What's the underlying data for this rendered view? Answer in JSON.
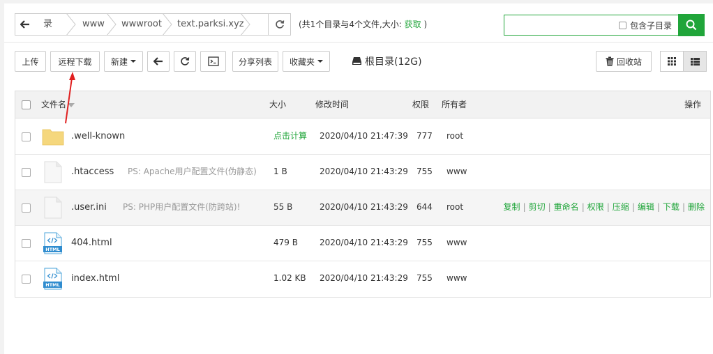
{
  "path": {
    "crumbs": [
      "录",
      "www",
      "wwwroot",
      "text.parksi.xyz"
    ],
    "info_prefix": "(共1个目录与4个文件,大小:",
    "info_link": "获取",
    "info_suffix": ")"
  },
  "search": {
    "placeholder": "",
    "subdir_label": "包含子目录"
  },
  "toolbar": {
    "upload": "上传",
    "remote_download": "远程下载",
    "new": "新建",
    "share_list": "分享列表",
    "favorites": "收藏夹",
    "root_dir": "根目录(12G)",
    "recycle_bin": "回收站"
  },
  "table": {
    "headers": {
      "name": "文件名",
      "size": "大小",
      "mtime": "修改时间",
      "perm": "权限",
      "owner": "所有者",
      "ops": "操作"
    },
    "rows": [
      {
        "name": ".well-known",
        "ps": "",
        "size": "点击计算",
        "mtime": "2020/04/10 21:47:39",
        "perm": "777",
        "owner": "root",
        "icon": "folder-icon"
      },
      {
        "name": ".htaccess",
        "ps": "PS: Apache用户配置文件(伪静态)",
        "size": "1 B",
        "mtime": "2020/04/10 21:43:29",
        "perm": "755",
        "owner": "www",
        "icon": "file-icon"
      },
      {
        "name": ".user.ini",
        "ps": "PS: PHP用户配置文件(防跨站)!",
        "size": "55 B",
        "mtime": "2020/04/10 21:43:29",
        "perm": "644",
        "owner": "root",
        "icon": "file-icon"
      },
      {
        "name": "404.html",
        "ps": "",
        "size": "479 B",
        "mtime": "2020/04/10 21:43:29",
        "perm": "755",
        "owner": "www",
        "icon": "html-file-icon"
      },
      {
        "name": "index.html",
        "ps": "",
        "size": "1.02 KB",
        "mtime": "2020/04/10 21:43:29",
        "perm": "755",
        "owner": "www",
        "icon": "html-file-icon"
      }
    ],
    "row_actions": [
      "复制",
      "剪切",
      "重命名",
      "权限",
      "压缩",
      "编辑",
      "下载",
      "删除"
    ],
    "html_badge": "HTML"
  },
  "colors": {
    "accent": "#20a53a",
    "annotation_arrow": "#e02020"
  }
}
